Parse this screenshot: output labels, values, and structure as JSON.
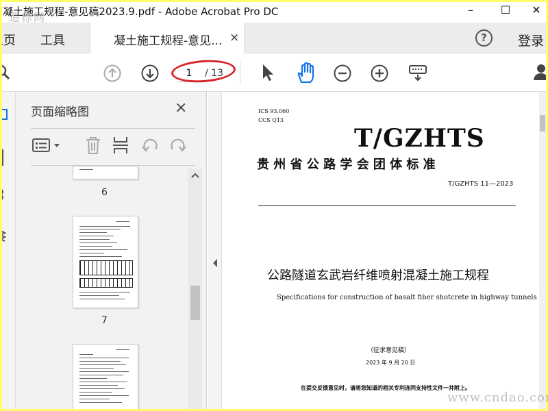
{
  "window": {
    "title": "凝土施工规程-意见稿2023.9.pdf - Adobe Acrobat Pro DC",
    "minimize": "–",
    "maximize": "☐",
    "close": "✕"
  },
  "watermarks": {
    "top": "造标网",
    "bottom": "www.cndao.com"
  },
  "menu": {
    "home": "主页",
    "tools": "工具",
    "doc_tab": "凝土施工规程-意见...",
    "doc_tab_close": "×",
    "help": "?",
    "login": "登录"
  },
  "toolbar": {
    "current_page": "1",
    "total_pages": "/ 13"
  },
  "thumbnails": {
    "title": "页面缩略图",
    "close": "×",
    "pages": [
      {
        "label": "6"
      },
      {
        "label": "7"
      }
    ]
  },
  "document": {
    "ics": "ICS  93.060",
    "ccs": "CCS Q13",
    "standard_code": "T/GZHTS",
    "organization": "贵 州 省 公 路 学 会 团 体 标 准",
    "number": "T/GZHTS 11—2023",
    "title_cn": "公路隧道玄武岩纤维喷射混凝土施工规程",
    "title_en": "Specifications for construction of basalt fiber shotcrete in highway tunnels",
    "draft": "（征求意见稿）",
    "date": "2023 年 9 月 20 日",
    "notice": "在提交反馈意见时，请将您知道的相关专利连同支持性文件一并附上。"
  },
  "colors": {
    "accent": "#d8262a",
    "hand_icon": "#1473e6"
  }
}
